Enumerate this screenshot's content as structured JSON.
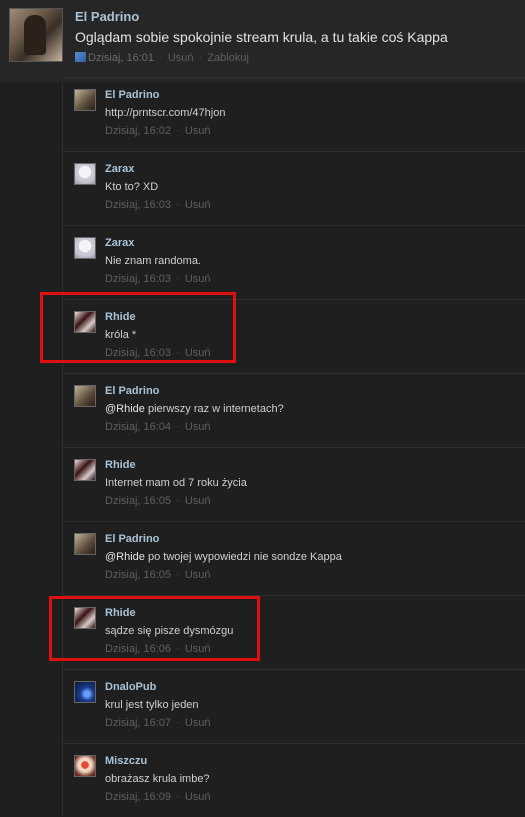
{
  "post": {
    "author": "El Padrino",
    "text": "Oglądam sobie spokojnie stream krula, a tu takie coś Kappa",
    "time": "Dzisiaj, 16:01",
    "delete": "Usuń",
    "block": "Zablokuj"
  },
  "comments": [
    {
      "author": "El Padrino",
      "mention": "",
      "text": "http://prntscr.com/47hjon",
      "time": "Dzisiaj, 16:02",
      "delete": "Usuń"
    },
    {
      "author": "Zarax",
      "mention": "",
      "text": "Kto to? XD",
      "time": "Dzisiaj, 16:03",
      "delete": "Usuń"
    },
    {
      "author": "Zarax",
      "mention": "",
      "text": "Nie znam randoma.",
      "time": "Dzisiaj, 16:03",
      "delete": "Usuń"
    },
    {
      "author": "Rhide",
      "mention": "",
      "text": "króla *",
      "time": "Dzisiaj, 16:03",
      "delete": "Usuń"
    },
    {
      "author": "El Padrino",
      "mention": "@Rhide",
      "text": " pierwszy raz w internetach?",
      "time": "Dzisiaj, 16:04",
      "delete": "Usuń"
    },
    {
      "author": "Rhide",
      "mention": "",
      "text": "Internet mam od 7 roku życia",
      "time": "Dzisiaj, 16:05",
      "delete": "Usuń"
    },
    {
      "author": "El Padrino",
      "mention": "@Rhide",
      "text": " po twojej wypowiedzi nie sondze Kappa",
      "time": "Dzisiaj, 16:05",
      "delete": "Usuń"
    },
    {
      "author": "Rhide",
      "mention": "",
      "text": "sądze się pisze dysmózgu",
      "time": "Dzisiaj, 16:06",
      "delete": "Usuń"
    },
    {
      "author": "DnaloPub",
      "mention": "",
      "text": "krul jest tylko jeden",
      "time": "Dzisiaj, 16:07",
      "delete": "Usuń"
    },
    {
      "author": "Miszczu",
      "mention": "",
      "text": "obrażasz krula imbe?",
      "time": "Dzisiaj, 16:09",
      "delete": "Usuń"
    }
  ],
  "separator": "·",
  "colors": {
    "background": "#1f1f1f",
    "author": "#a9c3d8",
    "highlight": "#e01010"
  }
}
